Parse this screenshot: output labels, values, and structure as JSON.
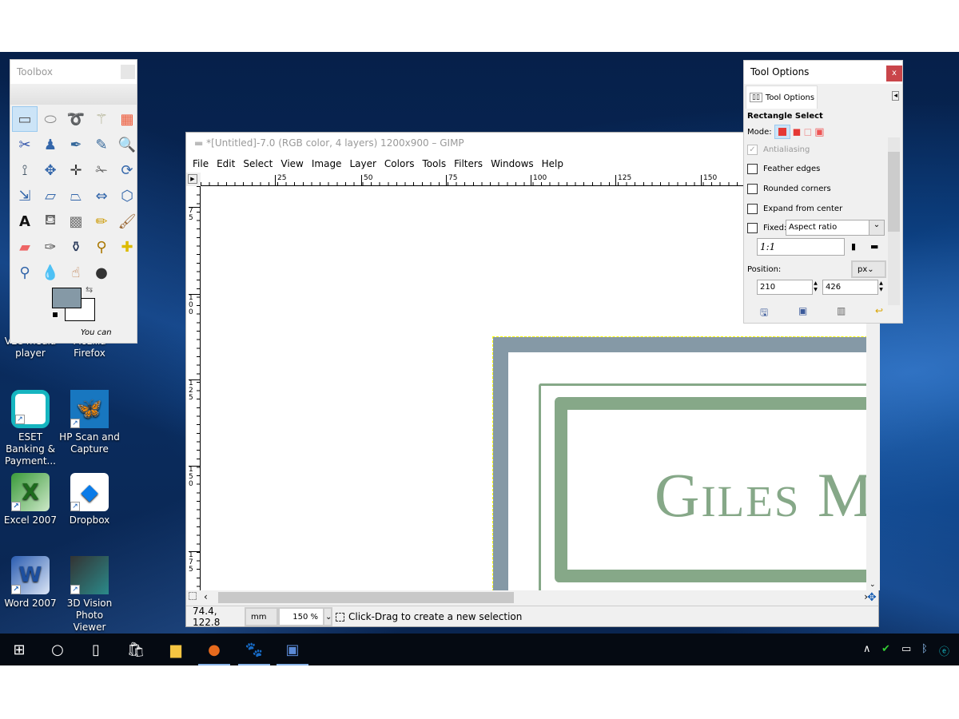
{
  "desktop": {
    "icons": [
      {
        "label": "VLC media player",
        "icon": "vlc-icon"
      },
      {
        "label": "Mozilla Firefox",
        "icon": "firefox-icon"
      },
      {
        "label": "ESET Banking & Payment...",
        "icon": "eset-icon"
      },
      {
        "label": "HP Scan and Capture",
        "icon": "hp-scan-icon"
      },
      {
        "label": "Excel 2007",
        "icon": "excel-icon"
      },
      {
        "label": "Dropbox",
        "icon": "dropbox-icon"
      },
      {
        "label": "Word 2007",
        "icon": "word-icon"
      },
      {
        "label": "3D Vision Photo Viewer",
        "icon": "3d-vision-icon"
      }
    ]
  },
  "toolbox": {
    "title": "Toolbox",
    "hint": "You can",
    "fg_color": "#8599a6",
    "bg_color": "#ffffff",
    "tools": [
      "rect-select",
      "ellipse-select",
      "free-select",
      "fuzzy-select",
      "select-by-color",
      "scissors-select",
      "foreground-select",
      "paths",
      "color-picker",
      "zoom",
      "measure",
      "move",
      "alignment",
      "crop",
      "rotate",
      "scale",
      "shear",
      "perspective",
      "flip",
      "cage-transform",
      "text",
      "bucket-fill",
      "blend",
      "pencil",
      "paintbrush",
      "eraser",
      "airbrush",
      "ink",
      "clone",
      "heal",
      "perspective-clone",
      "blur-sharpen",
      "smudge",
      "dodge-burn"
    ]
  },
  "gimp": {
    "title": "*[Untitled]-7.0 (RGB color, 4 layers) 1200x900 – GIMP",
    "menu": [
      "File",
      "Edit",
      "Select",
      "View",
      "Image",
      "Layer",
      "Colors",
      "Tools",
      "Filters",
      "Windows",
      "Help"
    ],
    "hruler": [
      "25",
      "50",
      "75",
      "100",
      "125",
      "150"
    ],
    "vruler": [
      "7\n5",
      "1\n0\n0",
      "1\n2\n5",
      "1\n5\n0",
      "1\n7\n5"
    ],
    "canvas_text": "Giles M",
    "status": {
      "coords": "74.4, 122.8",
      "unit": "mm",
      "zoom": "150 %",
      "message": "Click-Drag to create a new selection"
    }
  },
  "tool_options": {
    "title": "Tool Options",
    "tab": "Tool Options",
    "tool": "Rectangle Select",
    "mode_label": "Mode:",
    "antialiasing": "Antialiasing",
    "feather": "Feather edges",
    "rounded": "Rounded corners",
    "expand": "Expand from center",
    "fixed": "Fixed:",
    "fixed_value": "Aspect ratio",
    "ratio": "1:1",
    "position": "Position:",
    "unit": "px",
    "pos_x": "210",
    "pos_y": "426",
    "close": "x"
  },
  "taskbar": {
    "apps": [
      "start",
      "search",
      "task-view",
      "store",
      "file-explorer",
      "firefox",
      "gimp",
      "word"
    ]
  }
}
